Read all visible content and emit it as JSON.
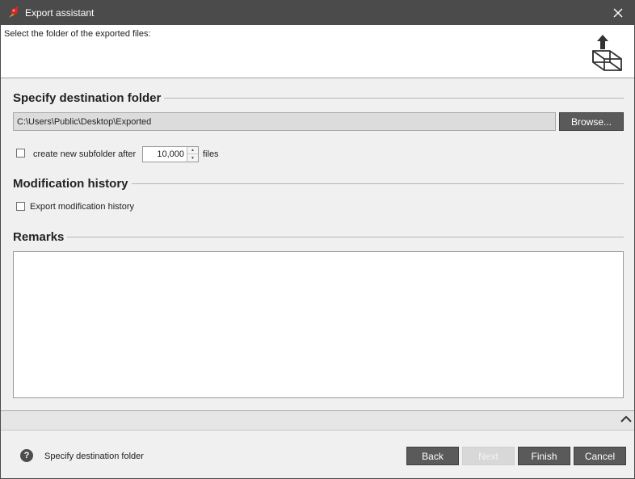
{
  "window": {
    "title": "Export assistant",
    "icons": {
      "app": "app-logo-icon",
      "close": "close-icon"
    }
  },
  "header": {
    "instruction": "Select the folder of the exported files:",
    "icon": "box-upload-icon"
  },
  "destination": {
    "section_title": "Specify destination folder",
    "path_value": "C:\\Users\\Public\\Desktop\\Exported",
    "browse_label": "Browse...",
    "subfolder_checked": false,
    "subfolder_label": "create new subfolder after",
    "subfolder_count": "10,000",
    "subfolder_suffix": "files"
  },
  "modification": {
    "section_title": "Modification history",
    "export_checked": false,
    "export_label": "Export modification history"
  },
  "remarks": {
    "section_title": "Remarks",
    "value": ""
  },
  "footer": {
    "help_icon": "question-circle-icon",
    "help_glyph": "?",
    "status_text": "Specify destination folder",
    "buttons": {
      "back": "Back",
      "next": "Next",
      "finish": "Finish",
      "cancel": "Cancel"
    },
    "next_enabled": false
  },
  "colors": {
    "titlebar": "#4b4b4b",
    "button": "#5a5a5a",
    "disabled_button": "#d8d8d8",
    "background": "#f0f0f0"
  }
}
